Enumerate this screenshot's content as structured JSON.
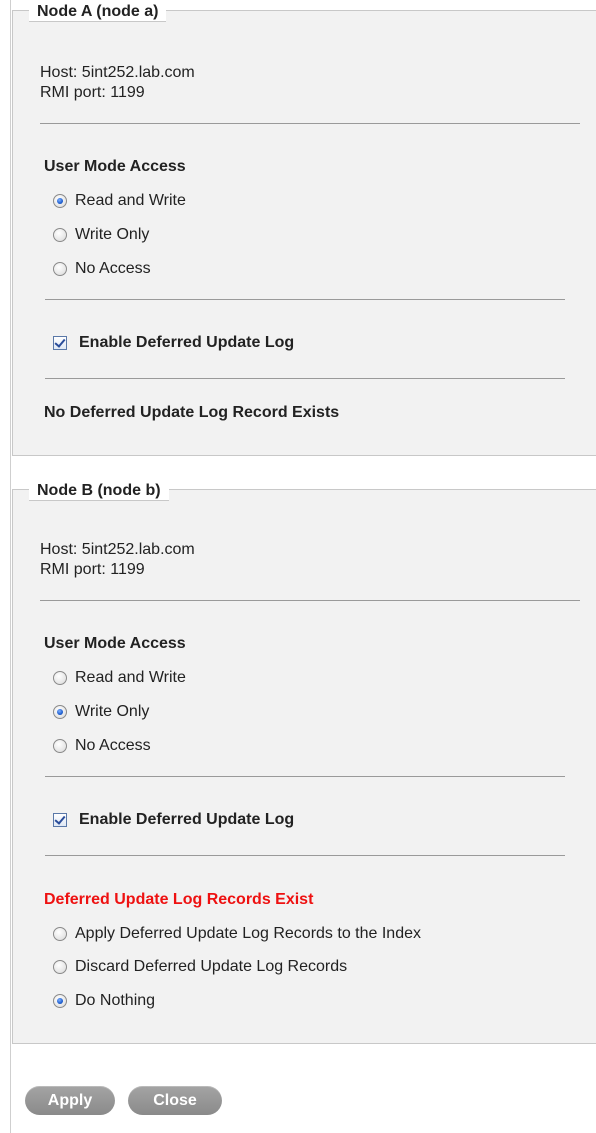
{
  "nodes": [
    {
      "title": "Node A (node a)",
      "host": "Host: 5int252.lab.com",
      "rmi_port": "RMI port: 1199",
      "user_mode_title": "User Mode Access",
      "access_options": [
        "Read and Write",
        "Write Only",
        "No Access"
      ],
      "selected_access": "Read and Write",
      "deferred_log_label": "Enable Deferred Update Log",
      "deferred_log_enabled": true,
      "log_status": "No Deferred Update Log Record Exists"
    },
    {
      "title": "Node B (node b)",
      "host": "Host: 5int252.lab.com",
      "rmi_port": "RMI port: 1199",
      "user_mode_title": "User Mode Access",
      "access_options": [
        "Read and Write",
        "Write Only",
        "No Access"
      ],
      "selected_access": "Write Only",
      "deferred_log_label": "Enable Deferred Update Log",
      "deferred_log_enabled": true,
      "log_status": "Deferred Update Log Records Exist",
      "log_status_color": "#ee1111",
      "log_actions": [
        "Apply Deferred Update Log Records to the Index",
        "Discard Deferred Update Log Records",
        "Do Nothing"
      ],
      "selected_log_action": "Do Nothing"
    }
  ],
  "buttons": {
    "apply": "Apply",
    "close": "Close"
  }
}
